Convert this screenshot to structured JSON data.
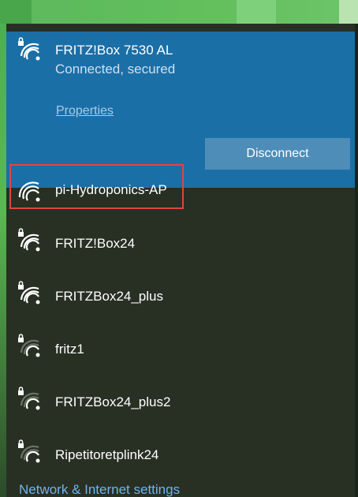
{
  "connected_network": {
    "name": "FRITZ!Box 7530 AL",
    "status": "Connected, secured",
    "properties_label": "Properties",
    "disconnect_label": "Disconnect"
  },
  "networks": [
    {
      "name": "pi-Hydroponics-AP",
      "secured": false,
      "signal": "full",
      "icon": "wifi-icon"
    },
    {
      "name": "FRITZ!Box24",
      "secured": true,
      "signal": "full",
      "icon": "wifi-secured-icon"
    },
    {
      "name": "FRITZBox24_plus",
      "secured": true,
      "signal": "full",
      "icon": "wifi-secured-icon"
    },
    {
      "name": "fritz1",
      "secured": true,
      "signal": "weak",
      "icon": "wifi-secured-icon"
    },
    {
      "name": "FRITZBox24_plus2",
      "secured": true,
      "signal": "weak",
      "icon": "wifi-secured-icon"
    },
    {
      "name": "Ripetitoretplink24",
      "secured": true,
      "signal": "weak",
      "icon": "wifi-secured-icon"
    }
  ],
  "footer": {
    "settings_label": "Network & Internet settings"
  },
  "colors": {
    "connected_bg": "#1b6fa7",
    "flyout_bg": "#283024",
    "highlight": "#e0453f",
    "link": "#6fb4ee"
  }
}
